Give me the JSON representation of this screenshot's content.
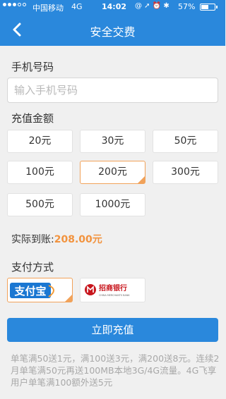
{
  "status_bar": {
    "carrier": "中国移动",
    "network": "4G",
    "time": "14:02",
    "icons": "@ ➚ ⏰ ✱",
    "battery_percent": "57%",
    "battery_level": 0.57
  },
  "nav": {
    "title": "安全交费"
  },
  "phone": {
    "label": "手机号码",
    "placeholder": "输入手机号码",
    "value": ""
  },
  "amount": {
    "label": "充值金额",
    "options": [
      "20元",
      "30元",
      "50元",
      "100元",
      "200元",
      "300元",
      "500元",
      "1000元"
    ],
    "selected": "200元"
  },
  "actual": {
    "label": "实际到账:",
    "value": "208.00元"
  },
  "payment": {
    "label": "支付方式",
    "methods": [
      {
        "name": "支付宝",
        "selected": true
      },
      {
        "name": "招商银行",
        "sub": "CHINA MERCHANTS BANK",
        "selected": false
      }
    ]
  },
  "submit_label": "立即充值",
  "note": "单笔满50送1元，满100送3元，满200送8元。连续2月单笔满50元再送100MB本地3G/4G流量。4G飞享用户单笔满100额外送5元"
}
